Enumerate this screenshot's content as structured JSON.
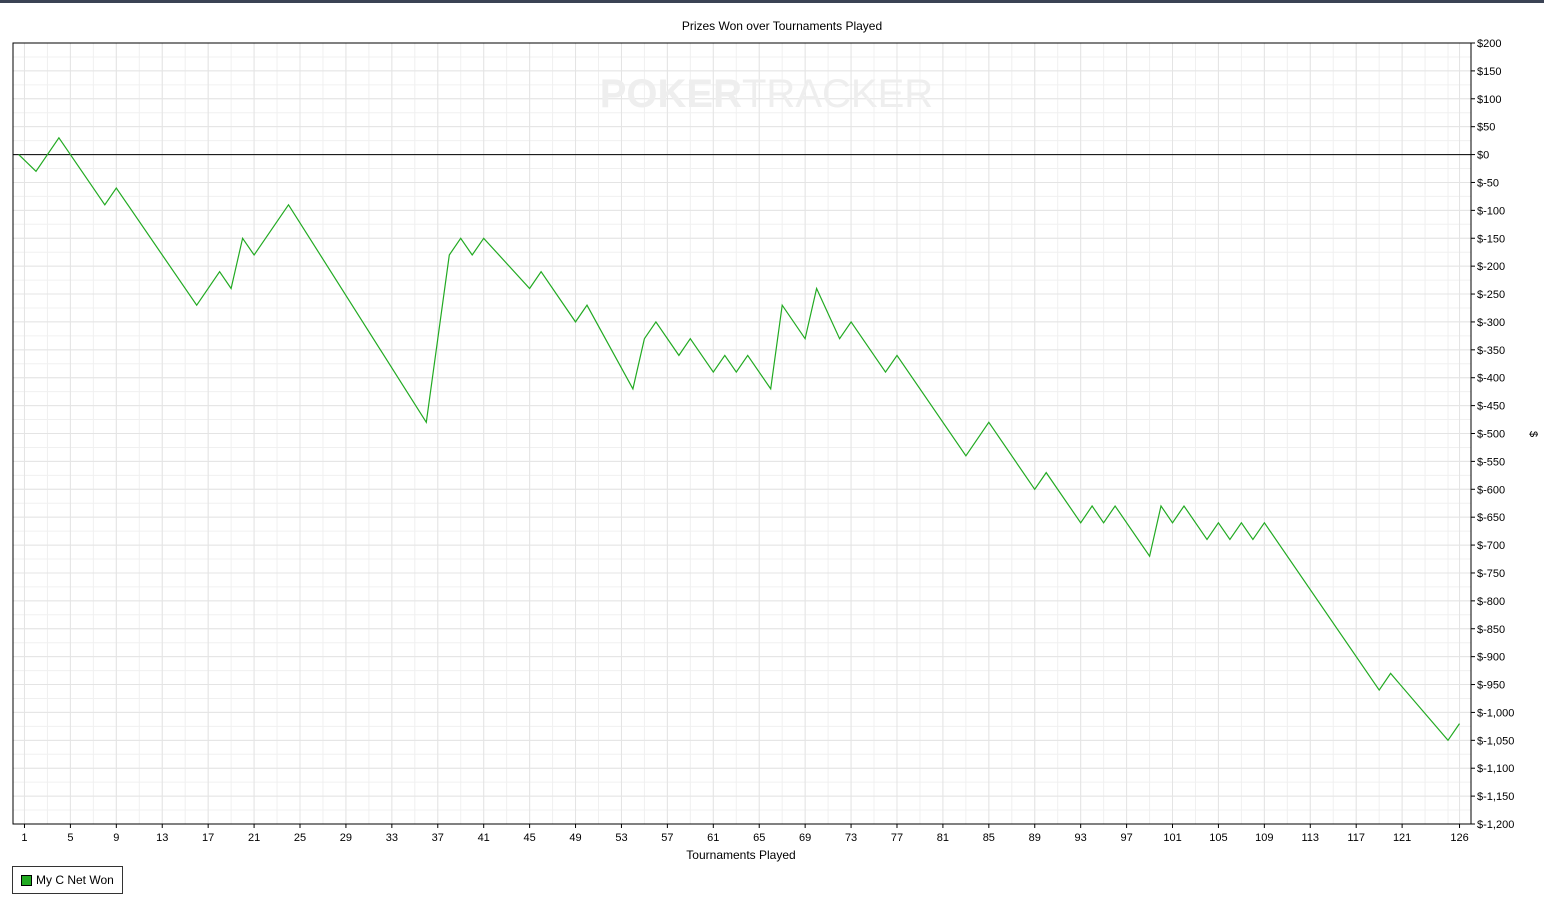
{
  "chart_data": {
    "type": "line",
    "title": "Prizes Won over Tournaments Played",
    "xlabel": "Tournaments Played",
    "ylabel": "$",
    "watermark": {
      "left": "POKER",
      "right": "TRACKER"
    },
    "ylim": [
      -1200,
      200
    ],
    "y_ticks": [
      200,
      150,
      100,
      50,
      0,
      -50,
      -100,
      -150,
      -200,
      -250,
      -300,
      -350,
      -400,
      -450,
      -500,
      -550,
      -600,
      -650,
      -700,
      -750,
      -800,
      -850,
      -900,
      -950,
      -1000,
      -1050,
      -1100,
      -1150,
      -1200
    ],
    "y_tick_labels": [
      "$200",
      "$150",
      "$100",
      "$50",
      "$0",
      "$-50",
      "$-100",
      "$-150",
      "$-200",
      "$-250",
      "$-300",
      "$-350",
      "$-400",
      "$-450",
      "$-500",
      "$-550",
      "$-600",
      "$-650",
      "$-700",
      "$-750",
      "$-800",
      "$-850",
      "$-900",
      "$-950",
      "$-1,000",
      "$-1,050",
      "$-1,100",
      "$-1,150",
      "$-1,200"
    ],
    "xlim": [
      0,
      127
    ],
    "x_ticks": [
      1,
      5,
      9,
      13,
      17,
      21,
      25,
      29,
      33,
      37,
      41,
      45,
      49,
      53,
      57,
      61,
      65,
      69,
      73,
      77,
      81,
      85,
      89,
      93,
      97,
      101,
      105,
      109,
      113,
      117,
      121,
      126
    ],
    "grid": true,
    "legend_position": "bottom-left",
    "series": [
      {
        "name": "My C Net Won",
        "color": "#22aa22",
        "x": [
          0.5,
          2,
          4,
          8,
          9,
          16,
          18,
          19,
          20,
          21,
          24,
          36,
          38,
          39,
          40,
          41,
          45,
          46,
          49,
          50,
          54,
          55,
          56,
          58,
          59,
          61,
          62,
          63,
          64,
          66,
          67,
          69,
          70,
          72,
          73,
          76,
          77,
          83,
          85,
          89,
          90,
          93,
          94,
          95,
          96,
          99,
          100,
          101,
          102,
          104,
          105,
          106,
          107,
          108,
          109,
          119,
          120,
          125,
          126
        ],
        "y": [
          0,
          -30,
          30,
          -90,
          -60,
          -270,
          -210,
          -240,
          -150,
          -180,
          -90,
          -480,
          -180,
          -150,
          -180,
          -150,
          -240,
          -210,
          -300,
          -270,
          -420,
          -330,
          -300,
          -360,
          -330,
          -390,
          -360,
          -390,
          -360,
          -420,
          -270,
          -330,
          -240,
          -330,
          -300,
          -390,
          -360,
          -540,
          -480,
          -600,
          -570,
          -660,
          -630,
          -660,
          -630,
          -720,
          -630,
          -660,
          -630,
          -690,
          -660,
          -690,
          -660,
          -690,
          -660,
          -960,
          -930,
          -1050,
          -1020
        ]
      }
    ]
  }
}
